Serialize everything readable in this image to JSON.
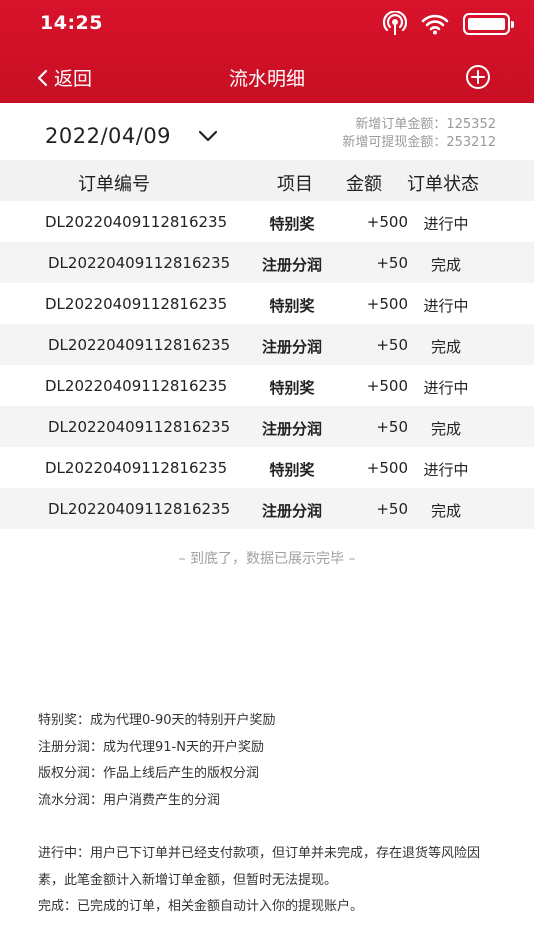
{
  "status_bar": {
    "time": "14:25"
  },
  "nav": {
    "back_label": "返回",
    "title": "流水明细"
  },
  "filter": {
    "date": "2022/04/09",
    "summary": [
      {
        "label": "新增订单金额：",
        "value": "125352"
      },
      {
        "label": "新增可提现金额：",
        "value": "253212"
      }
    ]
  },
  "table": {
    "headers": {
      "id": "订单编号",
      "item": "项目",
      "amount": "金额",
      "status": "订单状态"
    },
    "rows": [
      {
        "id": "DL20220409112816235",
        "item": "特别奖",
        "amount": "+500",
        "status": "进行中"
      },
      {
        "id": "DL20220409112816235",
        "item": "注册分润",
        "amount": "+50",
        "status": "完成"
      },
      {
        "id": "DL20220409112816235",
        "item": "特别奖",
        "amount": "+500",
        "status": "进行中"
      },
      {
        "id": "DL20220409112816235",
        "item": "注册分润",
        "amount": "+50",
        "status": "完成"
      },
      {
        "id": "DL20220409112816235",
        "item": "特别奖",
        "amount": "+500",
        "status": "进行中"
      },
      {
        "id": "DL20220409112816235",
        "item": "注册分润",
        "amount": "+50",
        "status": "完成"
      },
      {
        "id": "DL20220409112816235",
        "item": "特别奖",
        "amount": "+500",
        "status": "进行中"
      },
      {
        "id": "DL20220409112816235",
        "item": "注册分润",
        "amount": "+50",
        "status": "完成"
      }
    ]
  },
  "end_note": "– 到底了，数据已展示完毕 –",
  "legend": [
    "特别奖：成为代理0-90天的特别开户奖励",
    "注册分润：成为代理91-N天的开户奖励",
    "版权分润：作品上线后产生的版权分润",
    "流水分润：用户消费产生的分润"
  ],
  "explanations": [
    "进行中：用户已下订单并已经支付款项，但订单并未完成，存在退货等风险因素，此笔金额计入新增订单金额，但暂时无法提现。",
    "完成：已完成的订单，相关金额自动计入你的提现账户。"
  ],
  "colors": {
    "header_bg": "#d8132b",
    "row_alt_bg": "#f4f4f4",
    "muted_text": "#9a9a9a"
  }
}
